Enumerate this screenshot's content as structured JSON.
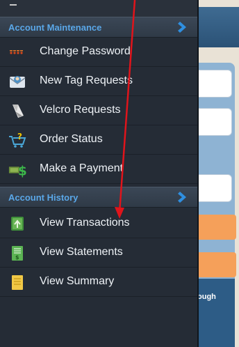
{
  "background_app": {
    "partial_text": "ough"
  },
  "sections": [
    {
      "title": "Account Maintenance",
      "items": [
        {
          "label": "Change Password",
          "icon": "password-dots-icon"
        },
        {
          "label": "New Tag Requests",
          "icon": "user-mail-icon"
        },
        {
          "label": "Velcro Requests",
          "icon": "velcro-strip-icon"
        },
        {
          "label": "Order Status",
          "icon": "cart-question-icon"
        },
        {
          "label": "Make a Payment",
          "icon": "money-icon"
        }
      ]
    },
    {
      "title": "Account History",
      "items": [
        {
          "label": "View Transactions",
          "icon": "transactions-icon"
        },
        {
          "label": "View Statements",
          "icon": "statement-icon"
        },
        {
          "label": "View Summary",
          "icon": "summary-note-icon"
        }
      ]
    }
  ],
  "colors": {
    "section_title": "#5aa7e8",
    "annotation_arrow": "#e0141b",
    "orange_button": "#f5a05a"
  }
}
